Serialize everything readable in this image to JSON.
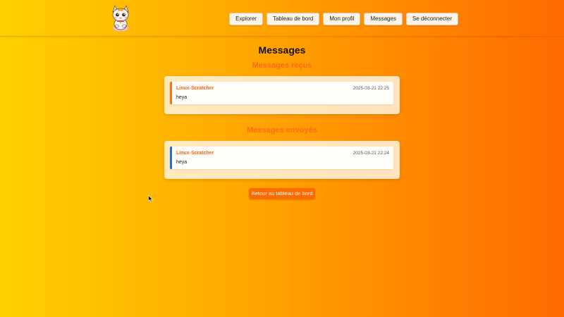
{
  "header": {
    "logo_icon": "cat-logo-icon",
    "nav": [
      {
        "label": "Explorer"
      },
      {
        "label": "Tableau de bord"
      },
      {
        "label": "Mon profil"
      },
      {
        "label": "Messages"
      },
      {
        "label": "Se déconnecter"
      }
    ]
  },
  "main": {
    "title": "Messages",
    "received": {
      "heading": "Messages reçus",
      "messages": [
        {
          "author": "Linux-Scratcher",
          "date": "2025-03-21 22:25",
          "text": "heya"
        }
      ]
    },
    "sent": {
      "heading": "Messages envoyés",
      "messages": [
        {
          "author": "Linux-Scratcher",
          "date": "2025-03-21 22:24",
          "text": "heya"
        }
      ]
    },
    "back_button": "Retour au tableau de bord"
  },
  "colors": {
    "accent": "#ff6a00",
    "received_border": "#ff7010",
    "sent_border": "#1f6fd8",
    "section_heading": "#ff6a1a"
  }
}
